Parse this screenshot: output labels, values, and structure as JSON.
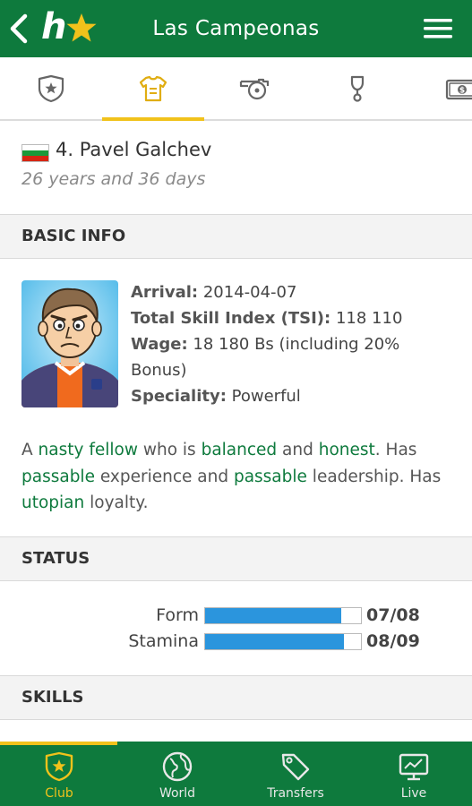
{
  "header": {
    "title": "Las Campeonas",
    "logo_letter": "h"
  },
  "tabs": [
    {
      "name": "club",
      "icon": "shield-star-icon",
      "active": false
    },
    {
      "name": "players",
      "icon": "shirt-icon",
      "active": true
    },
    {
      "name": "training",
      "icon": "whistle-icon",
      "active": false
    },
    {
      "name": "trophies",
      "icon": "trophy-icon",
      "active": false
    },
    {
      "name": "finances",
      "icon": "money-icon",
      "active": false
    }
  ],
  "player": {
    "flag": "bulgaria-flag",
    "name": "4. Pavel Galchev",
    "age": "26 years and 36 days"
  },
  "sections": {
    "basic_info": "BASIC INFO",
    "status": "STATUS",
    "skills": "SKILLS"
  },
  "basic_info": {
    "arrival_label": "Arrival:",
    "arrival_value": " 2014-04-07",
    "tsi_label": "Total Skill Index (TSI):",
    "tsi_value": " 118 110",
    "wage_label": "Wage:",
    "wage_value": " 18 180 Bs (including 20% Bonus)",
    "speciality_label": "Speciality:",
    "speciality_value": " Powerful"
  },
  "description": {
    "p1": "A ",
    "agreeability": "nasty fellow",
    "p2": " who is ",
    "aggressiveness": "balanced",
    "p3": " and ",
    "honesty": "honest",
    "p4": ". Has ",
    "experience": "passable",
    "p5": " experience and ",
    "leadership": "passable",
    "p6": " leadership. Has ",
    "loyalty": "utopian",
    "p7": " loyalty."
  },
  "status": [
    {
      "label": "Form",
      "value": "07/08",
      "fraction": 0.875
    },
    {
      "label": "Stamina",
      "value": "08/09",
      "fraction": 0.889
    }
  ],
  "bottom_nav": [
    {
      "label": "Club",
      "icon": "shield-star-icon",
      "active": true
    },
    {
      "label": "World",
      "icon": "globe-icon",
      "active": false
    },
    {
      "label": "Transfers",
      "icon": "tag-icon",
      "active": false
    },
    {
      "label": "Live",
      "icon": "monitor-chart-icon",
      "active": false
    }
  ],
  "colors": {
    "brand_green": "#0e7a3d",
    "accent_yellow": "#f1c21b",
    "bar_blue": "#2b95dd"
  }
}
